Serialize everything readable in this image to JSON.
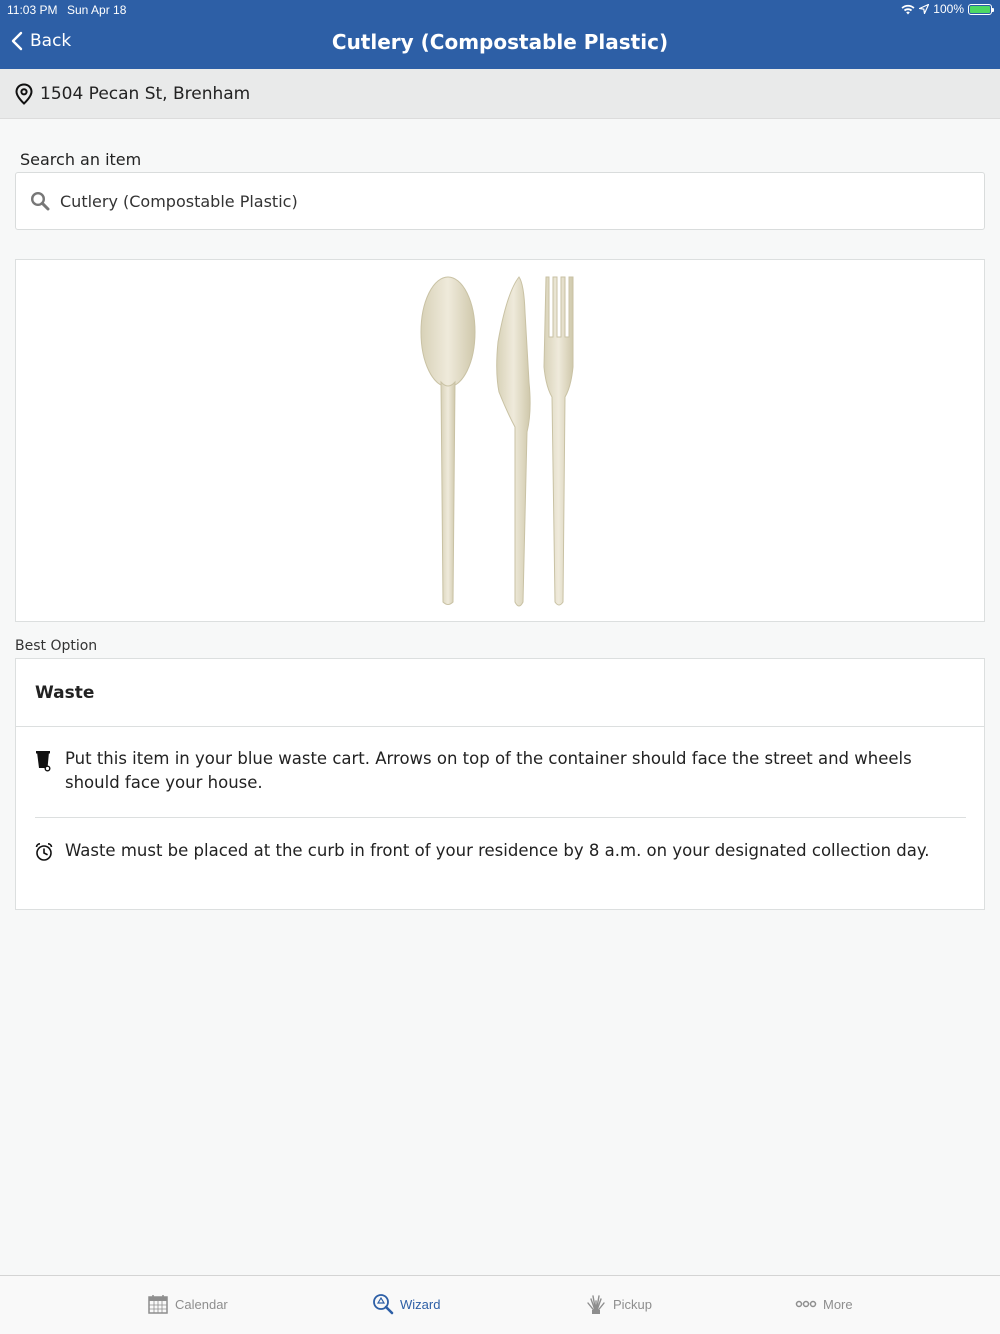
{
  "status_bar": {
    "time": "11:03 PM",
    "date": "Sun Apr 18",
    "battery": "100%",
    "battery_level": 1.0
  },
  "nav": {
    "back_label": "Back",
    "title": "Cutlery (Compostable Plastic)"
  },
  "address": {
    "text": "1504 Pecan St, Brenham",
    "icon": "location-pin-icon"
  },
  "search": {
    "label": "Search an item",
    "value": "Cutlery (Compostable Plastic)",
    "icon": "search-icon"
  },
  "item_image": {
    "depicts": [
      "spoon",
      "knife",
      "fork"
    ]
  },
  "result": {
    "section_label": "Best Option",
    "category": "Waste",
    "instructions": [
      {
        "icon": "trash-cart-icon",
        "text": "Put this item in your blue waste cart. Arrows on top of the container should face the street and wheels should face your house."
      },
      {
        "icon": "alarm-clock-icon",
        "text": "Waste must be placed at the curb in front of your residence by 8 a.m. on your designated collection day."
      }
    ]
  },
  "tabs": [
    {
      "label": "Calendar",
      "icon": "calendar-icon",
      "active": false
    },
    {
      "label": "Wizard",
      "icon": "recycle-search-icon",
      "active": true
    },
    {
      "label": "Pickup",
      "icon": "pickup-icon",
      "active": false
    },
    {
      "label": "More",
      "icon": "more-icon",
      "active": false
    }
  ],
  "colors": {
    "header_blue": "#2d5fa6",
    "active_tab": "#2d5fa6",
    "inactive_tab": "#8e8e8e",
    "battery_green": "#4cd964"
  }
}
